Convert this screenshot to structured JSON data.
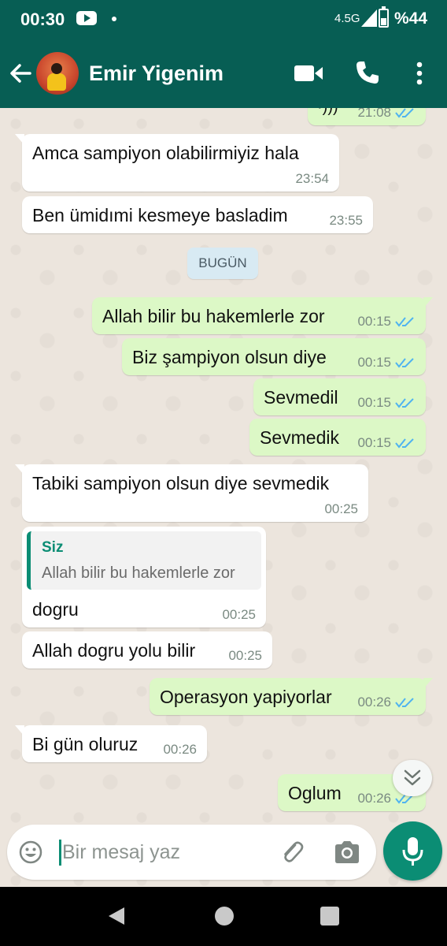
{
  "status_bar": {
    "time": "00:30",
    "network": "4.5G",
    "battery": "%44"
  },
  "header": {
    "contact_name": "Emir Yigenim",
    "icons": [
      "back-arrow-icon",
      "video-call-icon",
      "phone-icon",
      "more-vert-icon"
    ]
  },
  "messages": {
    "partial": {
      "text": "·)))",
      "time": "21:08"
    },
    "m1": {
      "text": "Amca sampiyon olabilirmiyiz hala",
      "time": "23:54"
    },
    "m2": {
      "text": "Ben ümidımi kesmeye basladim",
      "time": "23:55"
    },
    "date_chip": "BUGÜN",
    "m3": {
      "text": "Allah bilir bu hakemlerle zor",
      "time": "00:15"
    },
    "m4": {
      "text": "Biz şampiyon olsun diye",
      "time": "00:15"
    },
    "m5": {
      "text": "Sevmedil",
      "time": "00:15"
    },
    "m6": {
      "text": "Sevmedik",
      "time": "00:15"
    },
    "m7": {
      "text": "Tabiki sampiyon olsun diye sevmedik",
      "time": "00:25"
    },
    "m8": {
      "quote_author": "Siz",
      "quote_text": "Allah bilir bu hakemlerle zor",
      "text": "dogru",
      "time": "00:25"
    },
    "m9": {
      "text": "Allah dogru yolu bilir",
      "time": "00:25"
    },
    "m10": {
      "text": "Operasyon yapiyorlar",
      "time": "00:26"
    },
    "m11": {
      "text": "Bi gün oluruz",
      "time": "00:26"
    },
    "m12": {
      "text": "Oglum",
      "time": "00:26"
    }
  },
  "compose": {
    "placeholder": "Bir mesaj yaz"
  },
  "colors": {
    "header": "#075e54",
    "accent": "#0b8d74",
    "outgoing_bubble": "#dcf8c6",
    "incoming_bubble": "#ffffff",
    "read_ticks": "#4fb3f0"
  }
}
